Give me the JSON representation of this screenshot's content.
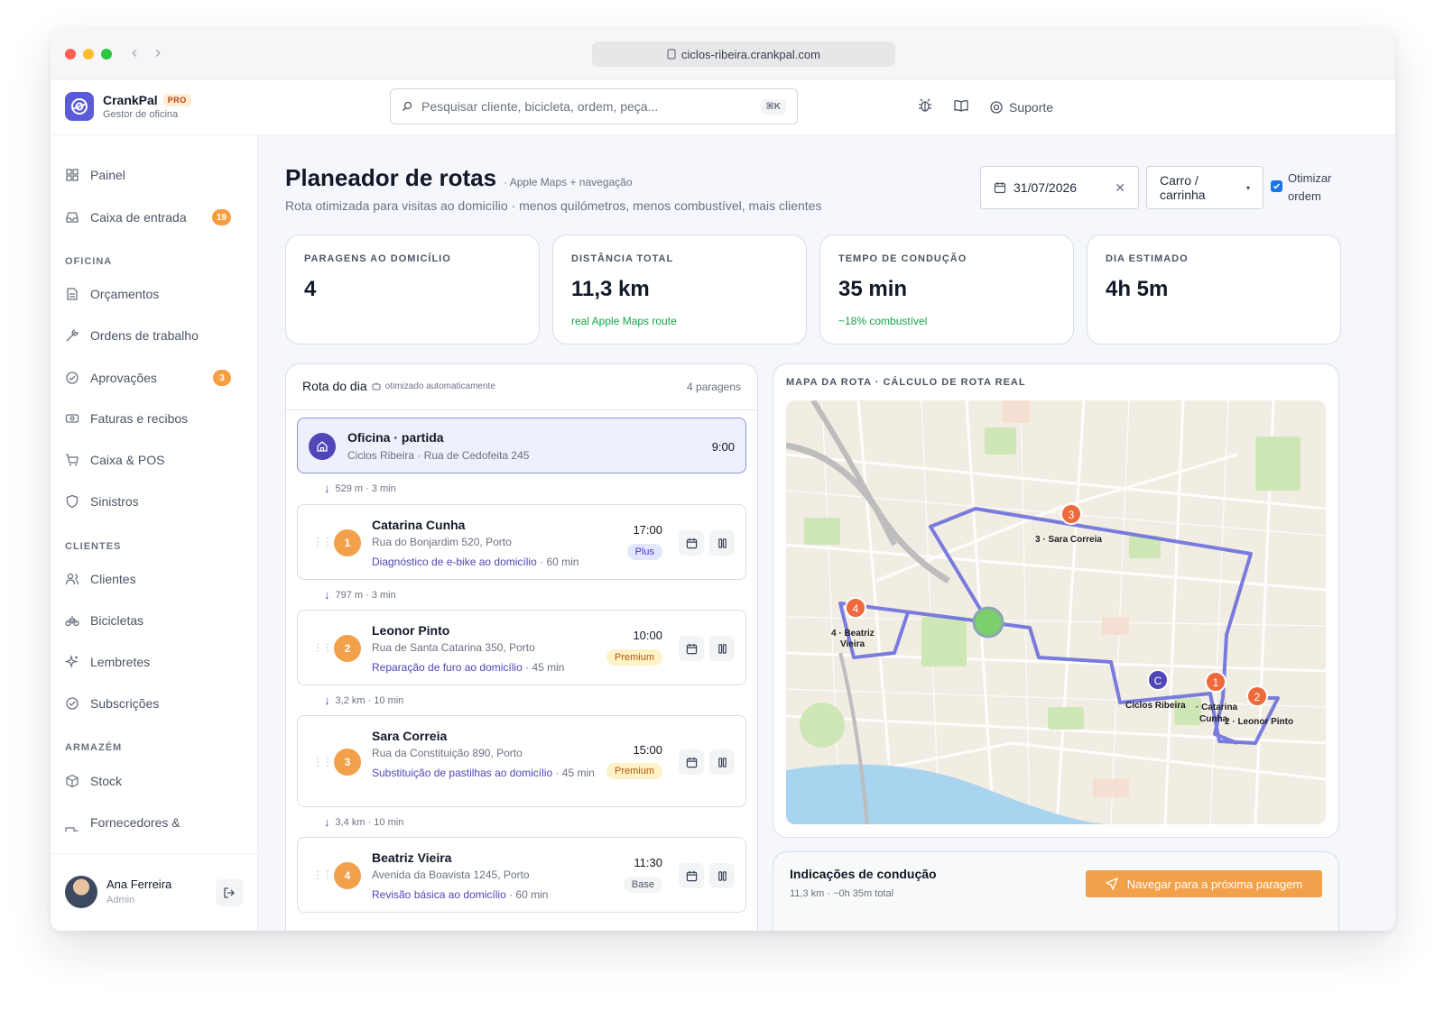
{
  "browser": {
    "url": "ciclos-ribeira.crankpal.com"
  },
  "brand": {
    "name": "CrankPal",
    "tier": "PRO",
    "subtitle": "Gestor de oficina"
  },
  "search": {
    "placeholder": "Pesquisar cliente, bicicleta, ordem, peça...",
    "shortcut": "⌘K"
  },
  "topbar": {
    "support_label": "Suporte",
    "icons": [
      "bug-icon",
      "book-icon",
      "lifebuoy-icon"
    ]
  },
  "sidebar": {
    "top_items": [
      {
        "label": "Painel",
        "icon": "grid-icon"
      },
      {
        "label": "Caixa de entrada",
        "icon": "inbox-icon",
        "badge": "19"
      }
    ],
    "sections": [
      {
        "title": "OFICINA",
        "items": [
          {
            "label": "Orçamentos",
            "icon": "document-icon"
          },
          {
            "label": "Ordens de trabalho",
            "icon": "wrench-icon"
          },
          {
            "label": "Aprovações",
            "icon": "check-circle-icon",
            "badge": "3"
          },
          {
            "label": "Faturas e recibos",
            "icon": "banknote-icon"
          },
          {
            "label": "Caixa & POS",
            "icon": "cart-icon"
          },
          {
            "label": "Sinistros",
            "icon": "shield-icon"
          }
        ]
      },
      {
        "title": "CLIENTES",
        "items": [
          {
            "label": "Clientes",
            "icon": "users-icon"
          },
          {
            "label": "Bicicletas",
            "icon": "bike-icon"
          },
          {
            "label": "Lembretes",
            "icon": "sparkle-icon"
          },
          {
            "label": "Subscrições",
            "icon": "check-circle-icon"
          }
        ]
      },
      {
        "title": "ARMAZÉM",
        "items": [
          {
            "label": "Stock",
            "icon": "box-icon"
          },
          {
            "label": "Fornecedores &",
            "icon": "truck-icon"
          }
        ]
      }
    ],
    "user": {
      "name": "Ana Ferreira",
      "role": "Admin"
    }
  },
  "page": {
    "title": "Planeador de rotas",
    "title_note": "· Apple Maps + navegação",
    "subtitle": "Rota otimizada para visitas ao domicílio · menos quilómetros, menos combustível, mais clientes",
    "date": "31/07/2026",
    "vehicle": "Carro / carrinha",
    "optimize_label_1": "Otimizar",
    "optimize_label_2": "ordem",
    "optimize_checked": true
  },
  "stats": [
    {
      "label": "PARAGENS AO DOMICÍLIO",
      "value": "4",
      "note": ""
    },
    {
      "label": "DISTÂNCIA TOTAL",
      "value": "11,3 km",
      "note": "real Apple Maps route"
    },
    {
      "label": "TEMPO DE CONDUÇÃO",
      "value": "35 min",
      "note": "~18% combustível"
    },
    {
      "label": "DIA ESTIMADO",
      "value": "4h 5m",
      "note": ""
    }
  ],
  "route": {
    "title": "Rota do dia",
    "auto_note": "otimizado automaticamente",
    "count": "4 paragens",
    "origin": {
      "name": "Oficina · partida",
      "address": "Ciclos Ribeira · Rua de Cedofeita 245",
      "time": "9:00"
    },
    "legs": [
      "529 m · 3 min",
      "797 m · 3 min",
      "3,2 km · 10 min",
      "3,4 km · 10 min"
    ],
    "stops": [
      {
        "num": "1",
        "name": "Catarina Cunha",
        "address": "Rua do Bonjardim 520, Porto",
        "service": "Diagnóstico de e-bike ao domicílio",
        "duration": "· 60 min",
        "time": "17:00",
        "tier": "Plus"
      },
      {
        "num": "2",
        "name": "Leonor Pinto",
        "address": "Rua de Santa Catarina 350, Porto",
        "service": "Reparação de furo ao domicílio",
        "duration": "· 45 min",
        "time": "10:00",
        "tier": "Premium"
      },
      {
        "num": "3",
        "name": "Sara Correia",
        "address": "Rua da Constituição 890, Porto",
        "service": "Substituição de pastilhas ao domicílio",
        "duration": "· 45 min",
        "time": "15:00",
        "tier": "Premium"
      },
      {
        "num": "4",
        "name": "Beatriz Vieira",
        "address": "Avenida da Boavista 1245, Porto",
        "service": "Revisão básica ao domicílio",
        "duration": "· 60 min",
        "time": "11:30",
        "tier": "Base"
      }
    ]
  },
  "map": {
    "title": "MAPA DA ROTA · CÁLCULO DE ROTA REAL",
    "pins": [
      {
        "marker": "3",
        "label": "3 · Sara Correia"
      },
      {
        "marker": "4",
        "label_1": "4 · Beatriz",
        "label_2": "Vieira"
      },
      {
        "marker": "C",
        "label": "Ciclos Ribeira"
      },
      {
        "marker": "1",
        "label_1": "· Catarina",
        "label_2": "Cunha"
      },
      {
        "marker": "2",
        "label": "2 · Leonor Pinto"
      }
    ],
    "colors": {
      "route": "#6b6fdc",
      "pin": "#ee6a3a",
      "origin_pin": "#4f46b8",
      "water": "#a9d4ef",
      "park": "#cde6b8"
    }
  },
  "driving": {
    "title": "Indicações de condução",
    "summary": "11,3 km · ~0h 35m total",
    "nav_button": "Navegar para a próxima paragem"
  },
  "colors": {
    "accent": "#5b5bd6",
    "orange": "#f2a04a",
    "green": "#16a34a"
  }
}
